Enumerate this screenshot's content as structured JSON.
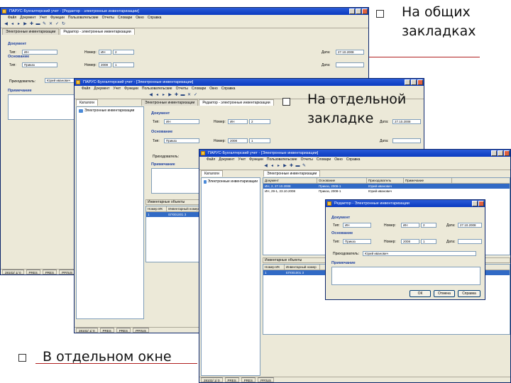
{
  "captions": {
    "shared_tabs": "На общих закладках",
    "separate_tab": "На отдельной закладке",
    "separate_window": "В отдельном окне"
  },
  "app_title": "ПАРУС-Бухгалтерский учет - [Электронные инвентаризации]",
  "app_title_editor": "ПАРУС-Бухгалтерский учет - [Редактор - электронные инвентаризации]",
  "menu": [
    "Файл",
    "Документ",
    "Учет",
    "Функции",
    "Пользовательские",
    "Отчеты",
    "Словари",
    "Окно",
    "Справка"
  ],
  "tabs": {
    "catalog": "Каталоги",
    "inventories": "Электронные инвентаризации",
    "editor": "Редактор - электронные инвентаризации"
  },
  "tree": {
    "item": "Электронные инвентаризации"
  },
  "form": {
    "document_label": "Документ",
    "basis_label": "Основание",
    "note_label": "Примечание",
    "type_label": "Тип:",
    "number_label": "Номер:",
    "date_label": "Дата:",
    "responsible_label": "Приходователь:",
    "doc_type": "ИН",
    "doc_prefix": "ИН",
    "doc_number": "2",
    "doc_date": "27.10.2008",
    "basis_type": "Приказ",
    "basis_prefix": "2008",
    "basis_number": "1",
    "responsible_value": "Юрий иванович"
  },
  "editor_window": {
    "title": "Редактор - Электронные инвентаризации",
    "ok": "ОК",
    "cancel": "Отмена",
    "help": "Справка"
  },
  "grid": {
    "headers": [
      "Документ",
      "Основание",
      "Приходователь",
      "Примечание"
    ],
    "rows": [
      [
        "ИН, 2, 27.10.2008",
        "Приказ, 2008-1",
        "Юрий иванович",
        ""
      ],
      [
        "ИН, 29-1, 23.10.2008",
        "Приказ, 2008-1",
        "Юрий иванович",
        ""
      ]
    ]
  },
  "lower_grid": {
    "title": "Инвентарные объекты",
    "headers": [
      "Номер ИК",
      "Инвентарный номер"
    ],
    "rows": [
      [
        "1",
        "ЕП001001 3"
      ]
    ]
  },
  "statusbar": [
    "28102/ 1/ 0",
    "PRES",
    "PRES",
    "РРЛUS",
    "РРЛUS"
  ]
}
